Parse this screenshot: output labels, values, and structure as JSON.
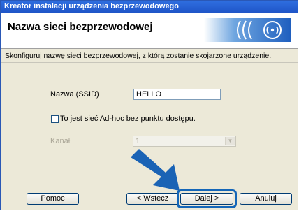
{
  "window": {
    "title": "Kreator instalacji urządzenia bezprzewodowego"
  },
  "header": {
    "title": "Nazwa sieci bezprzewodowej",
    "banner_icon": "wireless-signal-icon"
  },
  "description": "Skonfiguruj nazwę sieci bezprzewodowej, z którą zostanie skojarzone urządzenie.",
  "form": {
    "ssid_label": "Nazwa (SSID)",
    "ssid_value": "HELLO",
    "adhoc_label": "To jest sieć Ad-hoc bez punktu dostępu.",
    "adhoc_checked": false,
    "channel_label": "Kanał",
    "channel_value": "1"
  },
  "buttons": {
    "help": "Pomoc",
    "back": "< Wstecz",
    "next": "Dalej >",
    "cancel": "Anuluj"
  },
  "colors": {
    "title_bar": "#1f55c8",
    "accent_arrow": "#1a63b5",
    "highlight_border": "#1466b8",
    "banner_blue": "#2b6cc4"
  }
}
